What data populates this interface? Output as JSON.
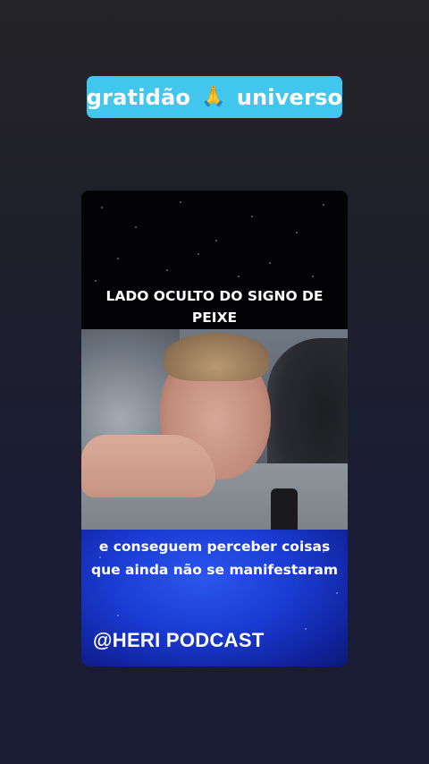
{
  "sticker": {
    "text_left": "gratidão",
    "emoji": "🙏",
    "text_right": "universo",
    "color": "#41c7ee"
  },
  "video_card": {
    "headline": "LADO OCULTO DO SIGNO DE PEIXE",
    "caption": "e conseguem perceber coisas que ainda não se manifestaram",
    "watermark": "@HERI PODCAST",
    "caption_bg_color": "#1a3bd2"
  }
}
